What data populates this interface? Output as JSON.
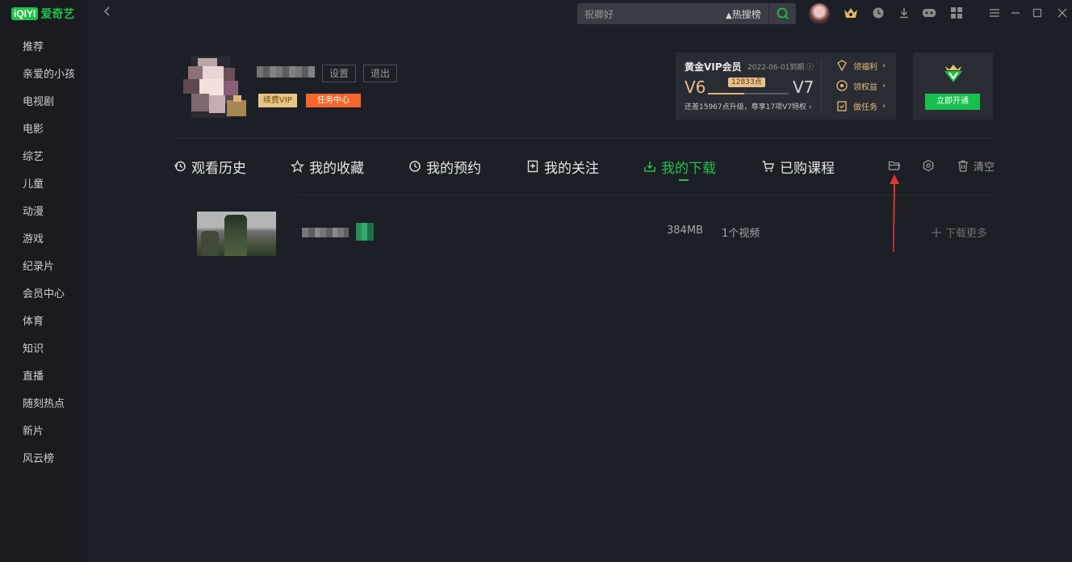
{
  "app": {
    "logo_mark": "iQIYI",
    "logo_name": "爱奇艺"
  },
  "sidebar": {
    "items": [
      {
        "label": "推荐"
      },
      {
        "label": "亲爱的小孩"
      },
      {
        "label": "电视剧"
      },
      {
        "label": "电影"
      },
      {
        "label": "综艺"
      },
      {
        "label": "儿童"
      },
      {
        "label": "动漫"
      },
      {
        "label": "游戏"
      },
      {
        "label": "纪录片"
      },
      {
        "label": "会员中心"
      },
      {
        "label": "体育"
      },
      {
        "label": "知识"
      },
      {
        "label": "直播"
      },
      {
        "label": "随刻热点"
      },
      {
        "label": "新片"
      },
      {
        "label": "风云榜"
      }
    ]
  },
  "search": {
    "placeholder": "祝卿好",
    "hot_label": "热搜榜"
  },
  "profile": {
    "settings_label": "设置",
    "logout_label": "退出",
    "renew_vip_label": "续费VIP",
    "task_center_label": "任务中心"
  },
  "vip": {
    "title": "黄金VIP会员",
    "expiry": "2022-06-01到期",
    "level_current": "V6",
    "level_next": "V7",
    "points": "12833点",
    "progress": 0.45,
    "note": "还差15967点升级，尊享17项V7特权",
    "links": [
      {
        "label": "领福利"
      },
      {
        "label": "领权益"
      },
      {
        "label": "做任务"
      }
    ],
    "open_label": "立即开通"
  },
  "tabs": [
    {
      "label": "观看历史",
      "icon": "history-icon"
    },
    {
      "label": "我的收藏",
      "icon": "star-icon"
    },
    {
      "label": "我的预约",
      "icon": "clock-icon"
    },
    {
      "label": "我的关注",
      "icon": "follow-icon"
    },
    {
      "label": "我的下载",
      "icon": "download-icon",
      "active": true
    },
    {
      "label": "已购课程",
      "icon": "cart-icon"
    }
  ],
  "toolbar": {
    "clear_label": "清空"
  },
  "download_row": {
    "size": "384MB",
    "count": "1个视频",
    "more_label": "下载更多"
  },
  "colors": {
    "accent": "#1fc14a",
    "vip_gold": "#e2bd7f",
    "task_orange": "#f4662a"
  }
}
